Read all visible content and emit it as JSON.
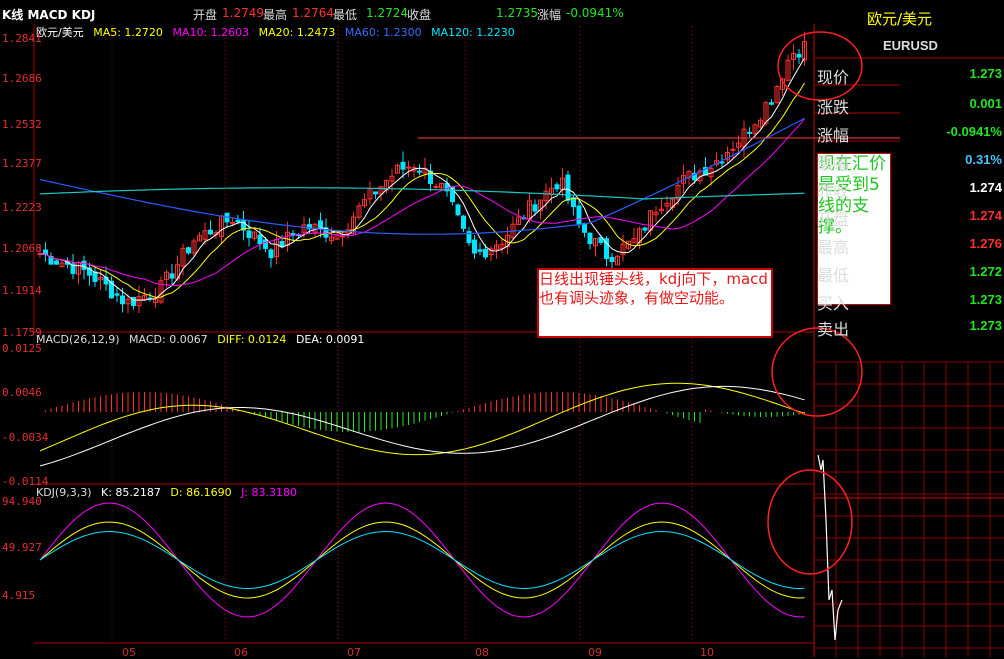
{
  "header": {
    "title": "K线 MACD KDJ",
    "open_label": "开盘",
    "open_value": "1.2749",
    "high_label": "最高",
    "high_value": "1.2764",
    "low_label": "最低",
    "low_value": "1.2724",
    "close_label": "收盘",
    "close_value": "1.2735",
    "change_label": "涨幅",
    "change_value": "-0.0941%"
  },
  "main_chart": {
    "legend": {
      "symbol": "欧元/美元",
      "ma5": "MA5: 1.2720",
      "ma10": "MA10: 1.2603",
      "ma20": "MA20: 1.2473",
      "ma60": "MA60: 1.2300",
      "ma120": "MA120: 1.2230"
    },
    "y_ticks": [
      "1.2841",
      "1.2686",
      "1.2532",
      "1.2377",
      "1.2223",
      "1.2068",
      "1.1914",
      "1.1759"
    ]
  },
  "macd_chart": {
    "legend": {
      "name": "MACD(26,12,9)",
      "macd": "MACD: 0.0067",
      "diff": "DIFF: 0.0124",
      "dea": "DEA: 0.0091"
    },
    "y_ticks": [
      "0.0125",
      "0.0046",
      "-0.0034",
      "-0.0114"
    ]
  },
  "kdj_chart": {
    "legend": {
      "name": "KDJ(9,3,3)",
      "k": "K: 85.2187",
      "d": "D: 86.1690",
      "j": "J: 83.3180"
    },
    "y_ticks": [
      "94.940",
      "49.927",
      "4.915"
    ]
  },
  "x_axis": {
    "months": [
      "05",
      "06",
      "07",
      "08",
      "09",
      "10"
    ]
  },
  "annotations": {
    "left_note": "日线出现锤头线，kdj向下，macd也有调头迹象，有做空动能。",
    "right_note": "现在汇价是受到5线的支撑。"
  },
  "quote_panel": {
    "pair_cn": "欧元/美元",
    "pair_code": "EURUSD",
    "rows": [
      {
        "label": "现价",
        "value": "1.273",
        "color": "#22e622"
      },
      {
        "label": "涨跌",
        "value": "0.001",
        "color": "#22e622"
      },
      {
        "label": "涨幅",
        "value": "-0.0941%",
        "color": "#22e622"
      },
      {
        "label": "震幅",
        "value": "0.31%",
        "color": "#4fc3ff"
      },
      {
        "label": "昨收",
        "value": "1.274",
        "color": "#ffffff"
      },
      {
        "label": "开盘",
        "value": "1.274",
        "color": "#ff3030"
      },
      {
        "label": "最高",
        "value": "1.276",
        "color": "#ff3030"
      },
      {
        "label": "最低",
        "value": "1.272",
        "color": "#22e622"
      },
      {
        "label": "买入",
        "value": "1.273",
        "color": "#22e622"
      },
      {
        "label": "卖出",
        "value": "1.273",
        "color": "#22e622"
      }
    ]
  },
  "colors": {
    "up": "#ff3030",
    "down": "#00e5ff",
    "ma5": "#ffffff",
    "ma10": "#ffff00",
    "ma20": "#ff00ff",
    "ma60": "#00ff00",
    "ma120": "#3aa0ff",
    "grid": "#8b0000"
  }
}
